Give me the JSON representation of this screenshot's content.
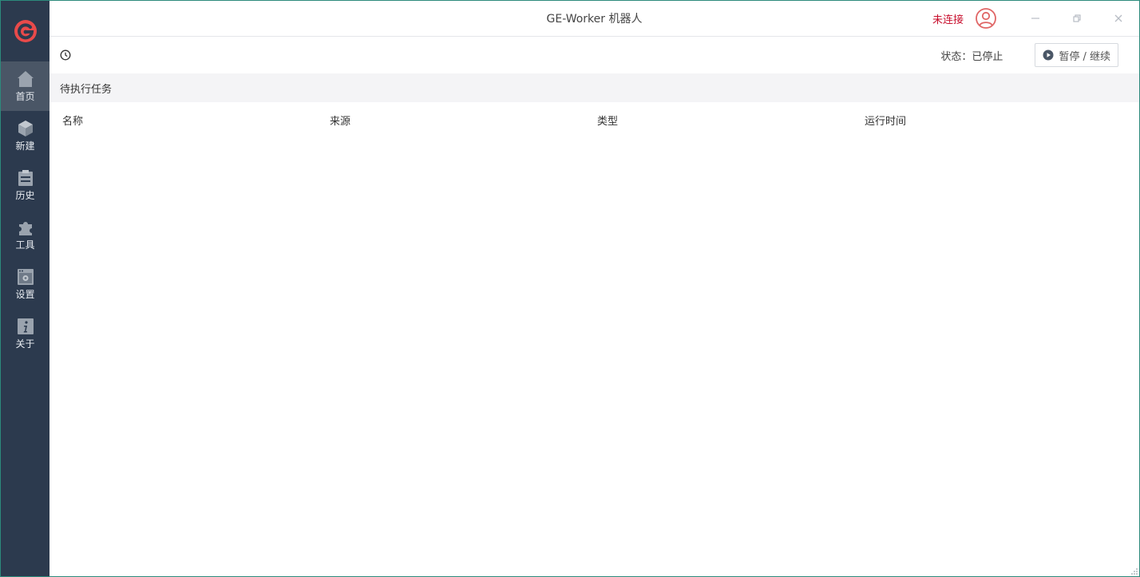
{
  "window": {
    "title": "GE-Worker 机器人",
    "connection_status": "未连接",
    "controls": {
      "minimize": "—",
      "restore": "▫",
      "close": "✕"
    }
  },
  "colors": {
    "sidebar_bg": "#2c3a4e",
    "sidebar_active": "#4a5666",
    "logo_red": "#e84a4a",
    "status_red": "#c8102e",
    "section_bg": "#f4f4f6"
  },
  "sidebar": {
    "logo_icon": "ge-logo-icon",
    "items": [
      {
        "label": "首页",
        "icon": "home-icon",
        "active": true
      },
      {
        "label": "新建",
        "icon": "cube-icon",
        "active": false
      },
      {
        "label": "历史",
        "icon": "history-icon",
        "active": false
      },
      {
        "label": "工具",
        "icon": "puzzle-icon",
        "active": false
      },
      {
        "label": "设置",
        "icon": "settings-icon",
        "active": false
      },
      {
        "label": "关于",
        "icon": "info-icon",
        "active": false
      }
    ]
  },
  "toolbar": {
    "status_text": "状态：已停止",
    "pause_button_label": "暂停 / 继续"
  },
  "tasks": {
    "section_title": "待执行任务",
    "columns": [
      "名称",
      "来源",
      "类型",
      "运行时间"
    ],
    "rows": []
  }
}
